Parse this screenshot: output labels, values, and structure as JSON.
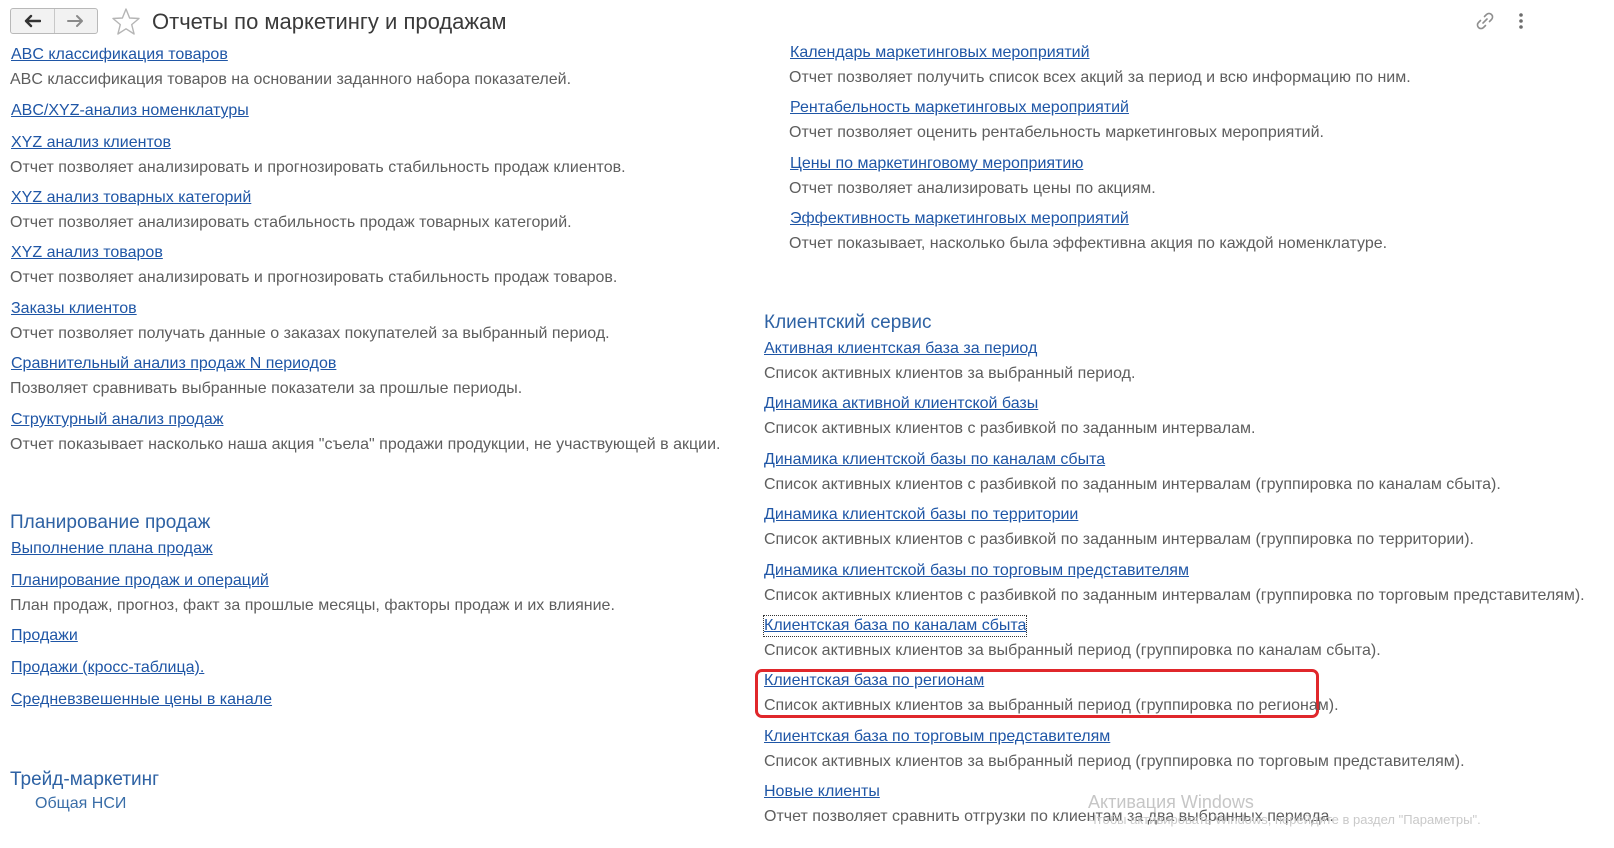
{
  "window": {
    "title": "Отчеты по маркетингу и продажам",
    "nav": {
      "back_icon": "arrow-left-icon",
      "forward_icon": "arrow-right-icon"
    },
    "favorite_icon": "star-icon",
    "link_icon": "link-icon",
    "menu_icon": "more-vertical-icon"
  },
  "colors": {
    "link": "#1f56a6",
    "section": "#2e62a4",
    "description": "#5e5e5e",
    "highlight": "#e0272b"
  },
  "left_column": [
    {
      "link": "ABC классификация товаров",
      "desc": "ABC классификация товаров на основании заданного набора показателей."
    },
    {
      "link": "ABC/XYZ-анализ номенклатуры"
    },
    {
      "link": "XYZ анализ клиентов",
      "desc": "Отчет позволяет анализировать и прогнозировать стабильность продаж клиентов."
    },
    {
      "link": "XYZ анализ товарных категорий",
      "desc": "Отчет позволяет анализировать стабильность продаж товарных категорий."
    },
    {
      "link": "XYZ анализ товаров",
      "desc": "Отчет позволяет анализировать и прогнозировать стабильность продаж товаров."
    },
    {
      "link": "Заказы клиентов",
      "desc": "Отчет позволяет получать данные о заказах покупателей за выбранный период."
    },
    {
      "link": "Сравнительный анализ продаж N периодов",
      "desc": "Позволяет сравнивать выбранные показатели за прошлые периоды."
    },
    {
      "link": "Структурный анализ продаж",
      "desc": "Отчет показывает насколько наша акция \"съела\" продажи продукции, не участвующей в акции."
    }
  ],
  "planning": {
    "title": "Планирование продаж",
    "items": [
      {
        "link": "Выполнение плана продаж"
      },
      {
        "link": "Планирование продаж и операций",
        "desc": "План продаж, прогноз, факт за прошлые месяцы, факторы продаж и их влияние."
      },
      {
        "link": "Продажи"
      },
      {
        "link": "Продажи (кросс-таблица)."
      },
      {
        "link": "Средневзвешенные цены в канале"
      }
    ]
  },
  "trade": {
    "title": "Трейд-маркетинг",
    "sub": "Общая НСИ"
  },
  "marketing_events": [
    {
      "link": "Календарь маркетинговых мероприятий",
      "desc": "Отчет позволяет получить список всех акций за период и всю информацию по ним."
    },
    {
      "link": "Рентабельность маркетинговых мероприятий",
      "desc": "Отчет позволяет оценить рентабельность маркетинговых мероприятий."
    },
    {
      "link": "Цены по маркетинговому мероприятию",
      "desc": "Отчет позволяет анализировать цены по акциям."
    },
    {
      "link": "Эффективность маркетинговых мероприятий",
      "desc": "Отчет показывает, насколько была эффективна акция по каждой номенклатуре."
    }
  ],
  "client_service": {
    "title": "Клиентский сервис",
    "items": [
      {
        "link": "Активная клиентская база за период",
        "desc": "Список активных клиентов за выбранный период."
      },
      {
        "link": "Динамика активной клиентской базы",
        "desc": "Список активных клиентов с разбивкой по заданным интервалам."
      },
      {
        "link": "Динамика клиентской базы по каналам сбыта",
        "desc": "Список активных клиентов с разбивкой по заданным интервалам (группировка по каналам сбыта)."
      },
      {
        "link": "Динамика клиентской базы по территории",
        "desc": "Список активных клиентов с разбивкой по заданным интервалам (группировка по территории)."
      },
      {
        "link": "Динамика клиентской базы по торговым представителям",
        "desc": "Список активных клиентов с разбивкой по заданным интервалам (группировка по торговым представителям)."
      },
      {
        "link": "Клиентская база по каналам сбыта",
        "desc": "Список активных клиентов за выбранный период (группировка по каналам сбыта)."
      },
      {
        "link": "Клиентская база по регионам",
        "desc": "Список активных клиентов за выбранный период (группировка по регионам)."
      },
      {
        "link": "Клиентская база по торговым представителям",
        "desc": "Список активных клиентов за выбранный период (группировка по торговым представителям)."
      },
      {
        "link": "Новые клиенты",
        "desc": "Отчет позволяет сравнить отгрузки по клиентам за два выбранных периода."
      }
    ]
  },
  "watermark": {
    "line1": "Активация Windows",
    "line2": "Чтобы активировать Windows, перейдите в раздел \"Параметры\"."
  }
}
